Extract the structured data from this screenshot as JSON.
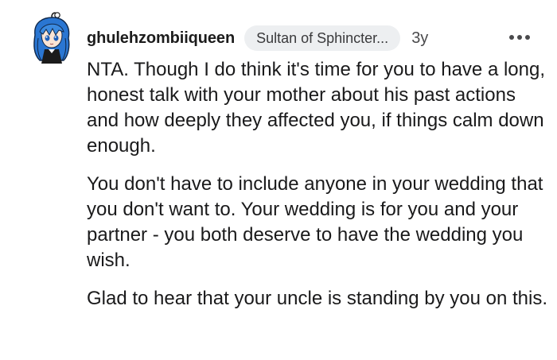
{
  "comment": {
    "username": "ghulehzombiiqueen",
    "flair": "Sultan of Sphincter...",
    "age": "3y",
    "paragraphs": [
      "NTA. Though I do think it's time for you to have a long, honest talk with your mother about his past actions and how deeply they affected you, if things calm down enough.",
      "You don't have to include anyone in your wedding that you don't want to. Your wedding is for you and your partner - you both deserve to have the wedding you wish.",
      "Glad to hear that your uncle is standing by you on this."
    ]
  },
  "icons": {
    "avatar": "user-avatar",
    "more": "more-options-icon"
  },
  "colors": {
    "flair_bg": "#edeff1",
    "avatar_hair": "#2d7bd6",
    "text": "#1a1a1b"
  }
}
